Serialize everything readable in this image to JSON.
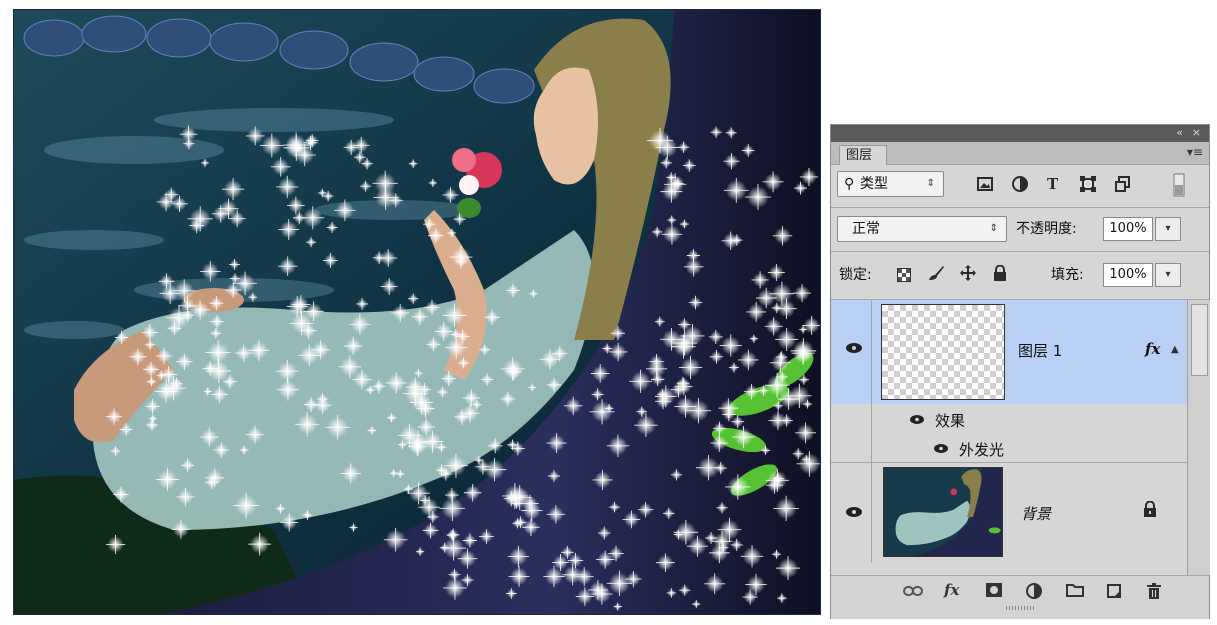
{
  "panel": {
    "collapse_icon": "«",
    "close_icon": "×",
    "tab_label": "图层",
    "menu_icon": "▾≡",
    "filter": {
      "search_icon": "⚲",
      "kind_label": "类型",
      "arrow": "⇕"
    },
    "filter_icons": [
      "image-icon",
      "adjustment-icon",
      "type-icon",
      "shape-icon",
      "smart-object-icon"
    ],
    "blend_mode": "正常",
    "opacity_label": "不透明度:",
    "opacity_value": "100%",
    "lock_label": "锁定:",
    "fill_label": "填充:",
    "fill_value": "100%",
    "layers": [
      {
        "name": "图层 1",
        "fx": "fx",
        "selected": true
      },
      {
        "name": "背景",
        "locked": true
      }
    ],
    "effects_label": "效果",
    "effect_item": "外发光"
  },
  "accent": {
    "selected_row": "#b9d0f5",
    "panel_bg": "#d6d6d6",
    "titlebar": "#5a5a5a"
  }
}
